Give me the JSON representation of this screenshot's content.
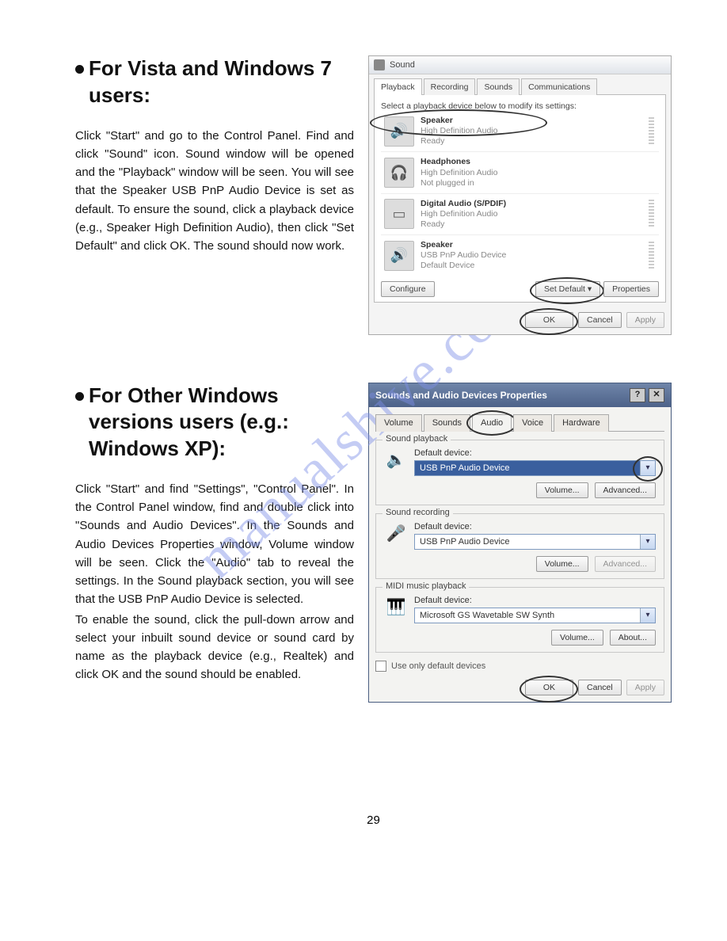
{
  "watermark": "manualshive.com",
  "page_number": "29",
  "section1": {
    "heading": "For Vista and Windows 7 users:",
    "body": "Click \"Start\" and go to the Control Panel. Find and click \"Sound\" icon. Sound window will be opened and the \"Playback\" window will be seen. You will see that the Speaker USB PnP Audio Device is set as default. To ensure the sound, click a playback device (e.g., Speaker High Definition Audio), then click \"Set Default\" and click OK. The sound should now work."
  },
  "section2": {
    "heading": "For Other Windows versions users (e.g.: Windows XP):",
    "body1": "Click \"Start\" and find \"Settings\", \"Control Panel\". In the Control Panel window, find and double click into \"Sounds and Audio Devices\". In the Sounds and Audio Devices Properties window, Volume window will be seen. Click the \"Audio\" tab to reveal the settings. In the Sound playback section, you will see that the USB PnP Audio Device is selected.",
    "body2": "To enable the sound, click the pull-down arrow and select your inbuilt sound device or sound card by name as the playback device (e.g., Realtek) and click OK and the sound should be enabled."
  },
  "win7": {
    "title": "Sound",
    "tabs": [
      "Playback",
      "Recording",
      "Sounds",
      "Communications"
    ],
    "instruction": "Select a playback device below to modify its settings:",
    "devices": [
      {
        "name": "Speaker",
        "desc": "High Definition Audio",
        "status": "Ready",
        "icon": "speaker",
        "circled": true
      },
      {
        "name": "Headphones",
        "desc": "High Definition Audio",
        "status": "Not plugged in",
        "icon": "headphone"
      },
      {
        "name": "Digital Audio (S/PDIF)",
        "desc": "High Definition Audio",
        "status": "Ready",
        "icon": "digital"
      },
      {
        "name": "Speaker",
        "desc": "USB PnP Audio Device",
        "status": "Default Device",
        "icon": "speaker"
      }
    ],
    "buttons": {
      "configure": "Configure",
      "set_default": "Set Default",
      "properties": "Properties",
      "ok": "OK",
      "cancel": "Cancel",
      "apply": "Apply"
    }
  },
  "xp": {
    "title": "Sounds and Audio Devices Properties",
    "tabs": [
      "Volume",
      "Sounds",
      "Audio",
      "Voice",
      "Hardware"
    ],
    "active_tab": "Audio",
    "group_playback": {
      "legend": "Sound playback",
      "label": "Default device:",
      "value": "USB PnP Audio Device",
      "btn_volume": "Volume...",
      "btn_advanced": "Advanced..."
    },
    "group_recording": {
      "legend": "Sound recording",
      "label": "Default device:",
      "value": "USB PnP Audio Device",
      "btn_volume": "Volume...",
      "btn_advanced": "Advanced..."
    },
    "group_midi": {
      "legend": "MIDI music playback",
      "label": "Default device:",
      "value": "Microsoft GS Wavetable SW Synth",
      "btn_volume": "Volume...",
      "btn_about": "About..."
    },
    "checkbox": "Use only default devices",
    "buttons": {
      "ok": "OK",
      "cancel": "Cancel",
      "apply": "Apply"
    }
  }
}
